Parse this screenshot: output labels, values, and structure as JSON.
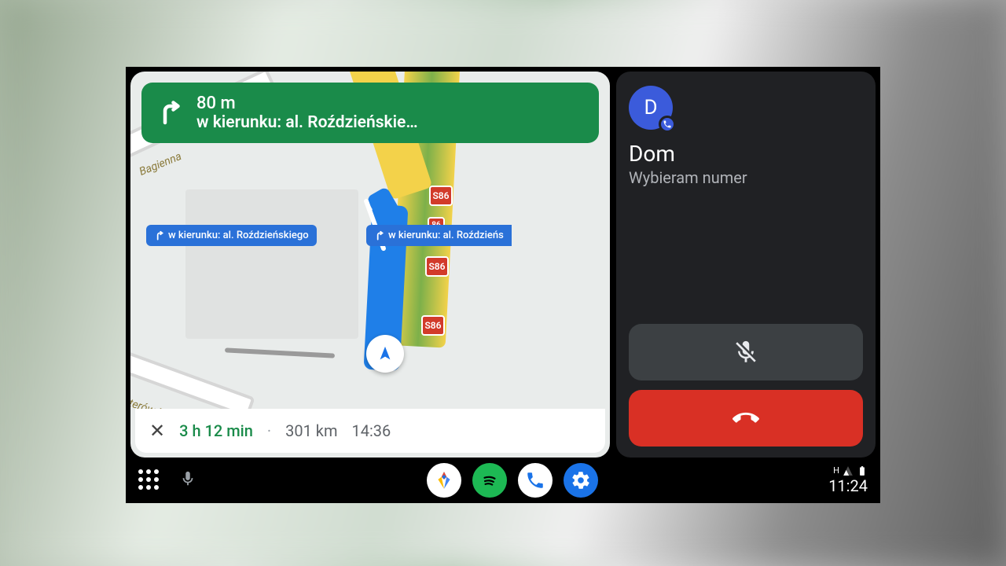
{
  "nav": {
    "distance": "80 m",
    "destination": "w kierunku:  al. Roździeńskie…",
    "lane_hint_1": "w kierunku: al. Roździeńskiego",
    "lane_hint_2": "w kierunku: al. Roździeńs",
    "road_shield": "S86",
    "road_shield_small": "86",
    "street_label_1": "Bagienna",
    "street_label_2": "aterów M"
  },
  "eta": {
    "duration": "3 h 12 min",
    "distance": "301 km",
    "arrival": "14:36"
  },
  "call": {
    "avatar_letter": "D",
    "name": "Dom",
    "status": "Wybieram numer"
  },
  "statusbar": {
    "network": "H",
    "clock": "11:24"
  }
}
